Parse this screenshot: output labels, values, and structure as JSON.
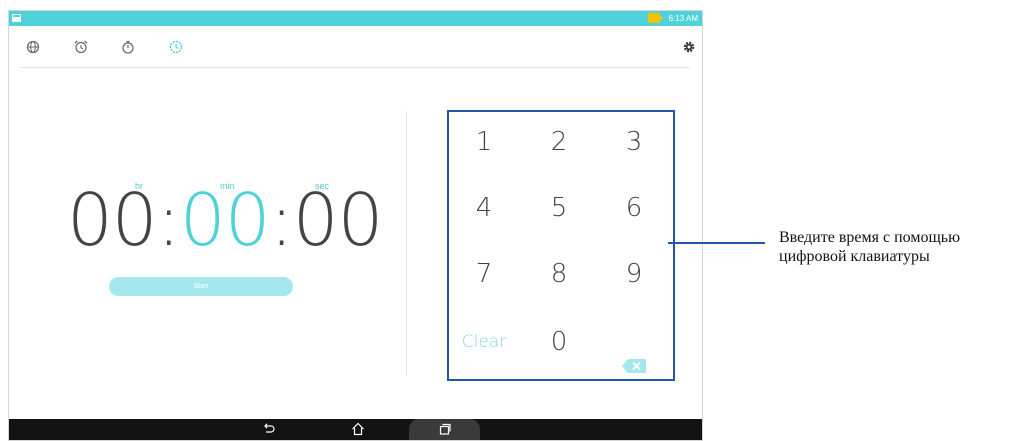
{
  "status_bar": {
    "time": "6:13 AM"
  },
  "toolbar": {
    "icons": [
      "world-clock-icon",
      "alarm-icon",
      "stopwatch-icon",
      "timer-icon",
      "settings-icon"
    ],
    "active_color": "#4fd1d9"
  },
  "timer": {
    "hours": "00",
    "minutes": "00",
    "seconds": "00",
    "hr_label": "hr",
    "min_label": "min",
    "sec_label": "sec",
    "start_label": "Start"
  },
  "keypad": {
    "keys": [
      "1",
      "2",
      "3",
      "4",
      "5",
      "6",
      "7",
      "8",
      "9"
    ],
    "clear_label": "Clear",
    "zero": "0",
    "backspace_icon": "backspace-icon"
  },
  "nav": {
    "icons": [
      "back-icon",
      "home-icon",
      "recents-icon"
    ]
  },
  "callout": {
    "line1": "Введите время с помощью",
    "line2": "цифровой клавиатуры"
  },
  "colors": {
    "accent": "#4fd1d9",
    "start_button": "#a4e7ec",
    "callout_border": "#2255a6",
    "text": "#444444"
  }
}
